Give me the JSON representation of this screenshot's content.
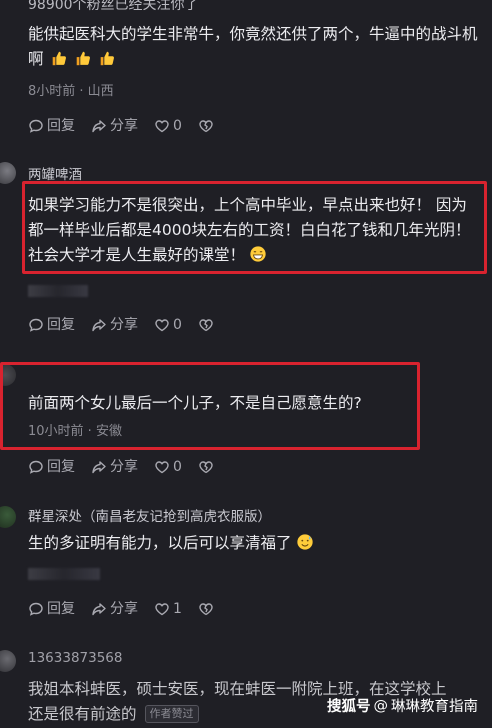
{
  "top_partial": "98900个粉丝已经关注你了",
  "comments": [
    {
      "text": "能供起医科大的学生非常牛，你竟然还供了两个，牛逼中的战斗机啊",
      "emoji": "thumbs-up x3",
      "meta": "8小时前 · 山西",
      "actions": {
        "reply": "回复",
        "share": "分享",
        "likes": "0"
      }
    },
    {
      "username": "两罐啤酒",
      "text": "如果学习能力不是很突出，上个高中毕业，早点出来也好！ 因为都一样毕业后都是4000块左右的工资！白白花了钱和几年光阴！ 社会大学才是人生最好的课堂！",
      "emoji": "grin",
      "actions": {
        "reply": "回复",
        "share": "分享",
        "likes": "0"
      }
    },
    {
      "username": "",
      "text": "前面两个女儿最后一个儿子，不是自己愿意生的?",
      "meta": "10小时前 · 安徽",
      "actions": {
        "reply": "回复",
        "share": "分享",
        "likes": "0"
      }
    },
    {
      "username": "群星深处（南昌老友记抢到高虎衣服版）",
      "text": "生的多证明有能力，以后可以享清福了",
      "emoji": "sweat-smile",
      "actions": {
        "reply": "回复",
        "share": "分享",
        "likes": "1"
      }
    },
    {
      "username": "13633873568",
      "text": "我姐本科蚌医，硕士安医，现在蚌医一附院上班，在这学校上还是很有前途的",
      "author_tag": "作者赞过"
    }
  ],
  "watermark": {
    "source": "搜狐号",
    "separator": "@",
    "account": "琳琳教育指南"
  },
  "colors": {
    "background": "#1f1f25",
    "highlight": "#d8232f",
    "muted": "#8b8b93"
  }
}
